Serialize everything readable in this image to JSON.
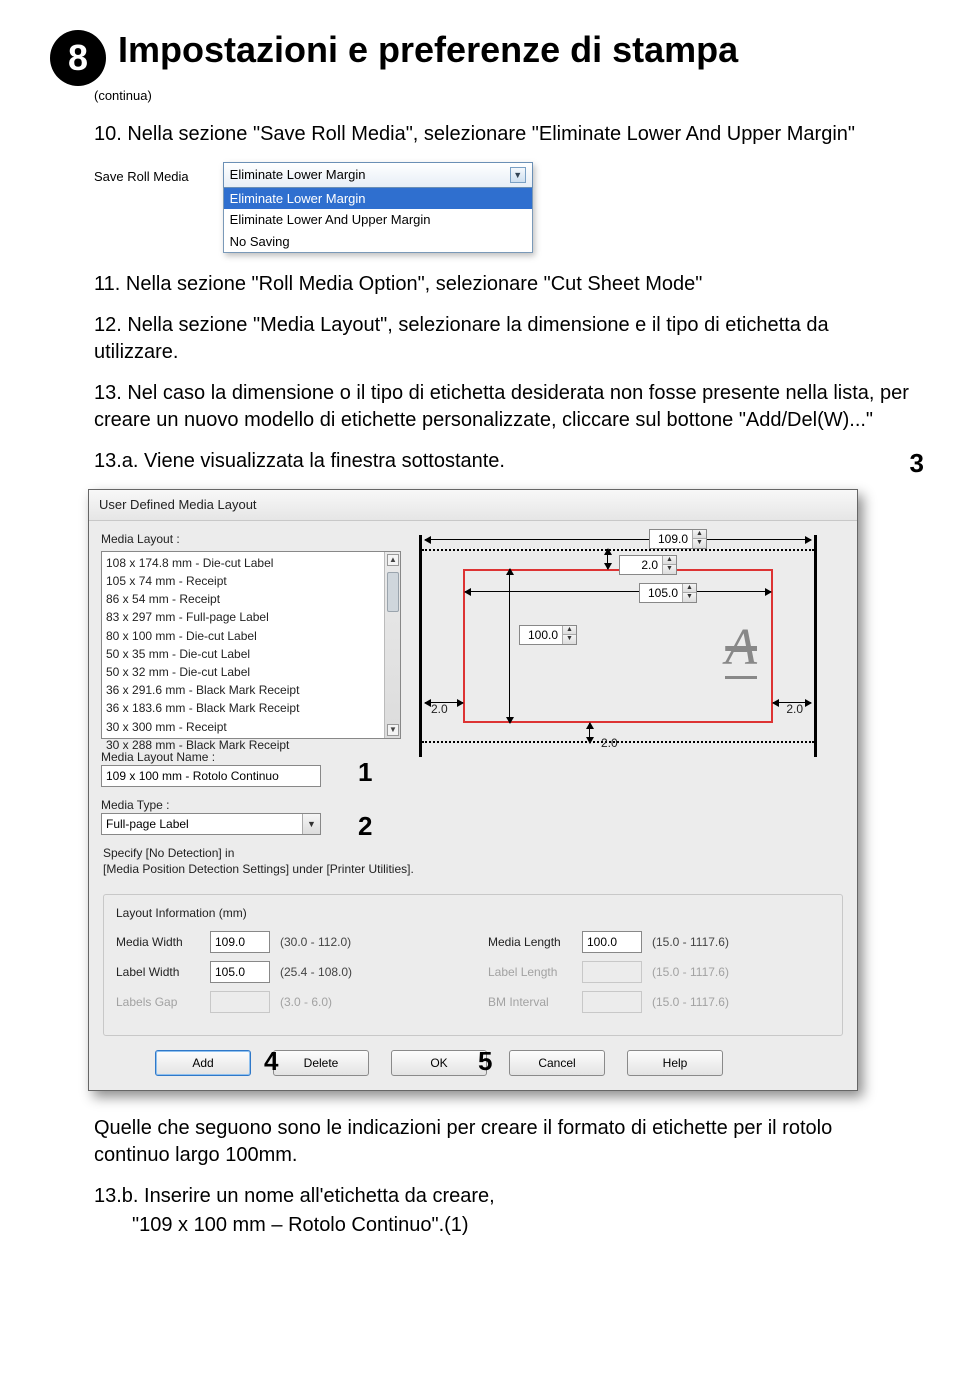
{
  "header": {
    "step_number": "8",
    "title": "Impostazioni e preferenze di stampa",
    "continua": "(continua)"
  },
  "items": {
    "p10": "10. Nella sezione \"Save Roll Media\", selezionare \"Eliminate Lower And Upper Margin\"",
    "p11": "11. Nella sezione \"Roll Media Option\", selezionare \"Cut Sheet Mode\"",
    "p12": "12. Nella sezione \"Media Layout\", selezionare la dimensione e il tipo di etichetta da utilizzare.",
    "p13": "13. Nel caso la dimensione o il tipo di etichetta desiderata non fosse presente nella lista, per creare un nuovo modello di etichette personalizzate, cliccare sul bottone \"Add/Del(W)...\"",
    "p13a": "13.a. Viene visualizzata la finestra sottostante."
  },
  "dropdown": {
    "label": "Save Roll Media",
    "current": "Eliminate Lower Margin",
    "opts": [
      "Eliminate Lower Margin",
      "Eliminate Lower And Upper Margin",
      "No Saving"
    ]
  },
  "callouts": {
    "c3": "3",
    "c1": "1",
    "c2": "2",
    "c4": "4",
    "c5": "5"
  },
  "dialog": {
    "title": "User Defined Media Layout",
    "media_layout_label": "Media Layout :",
    "layouts": [
      "108 x 174.8 mm - Die-cut Label",
      "105 x 74 mm - Receipt",
      "86 x 54 mm - Receipt",
      "83 x 297 mm - Full-page Label",
      "80 x 100 mm - Die-cut Label",
      "50 x 35 mm - Die-cut Label",
      "50 x 32 mm - Die-cut Label",
      "36 x 291.6 mm - Black Mark Receipt",
      "36 x 183.6 mm - Black Mark Receipt",
      "30 x 300 mm - Receipt",
      "30 x 288 mm - Black Mark Receipt"
    ],
    "name_label": "Media Layout Name :",
    "name_value": "109 x 100 mm - Rotolo Continuo",
    "type_label": "Media Type :",
    "type_value": "Full-page Label",
    "preview": {
      "w": "109.0",
      "top": "2.0",
      "lw": "105.0",
      "h": "100.0",
      "ml": "2.0",
      "mb": "2.0",
      "mr": "2.0"
    },
    "hint": "Specify [No Detection] in\n[Media Position Detection Settings] under [Printer Utilities].",
    "group_title": "Layout Information (mm)",
    "fields": {
      "mw_l": "Media Width",
      "mw_v": "109.0",
      "mw_r": "(30.0 - 112.0)",
      "lw_l": "Label Width",
      "lw_v": "105.0",
      "lw_r": "(25.4 - 108.0)",
      "lg_l": "Labels Gap",
      "lg_v": "",
      "lg_r": "(3.0 - 6.0)",
      "ml_l": "Media Length",
      "ml_v": "100.0",
      "ml_r": "(15.0 - 1117.6)",
      "ll_l": "Label Length",
      "ll_v": "",
      "ll_r": "(15.0 - 1117.6)",
      "bm_l": "BM Interval",
      "bm_v": "",
      "bm_r": "(15.0 - 1117.6)"
    },
    "buttons": {
      "add": "Add",
      "del": "Delete",
      "ok": "OK",
      "cancel": "Cancel",
      "help": "Help"
    }
  },
  "footer": {
    "para": "Quelle che seguono sono le indicazioni per creare il formato di etichette per il rotolo continuo largo 100mm.",
    "p13b_a": "13.b. Inserire un nome all'etichetta da creare,",
    "p13b_b": "\"109 x 100 mm – Rotolo Continuo\".(1)"
  }
}
